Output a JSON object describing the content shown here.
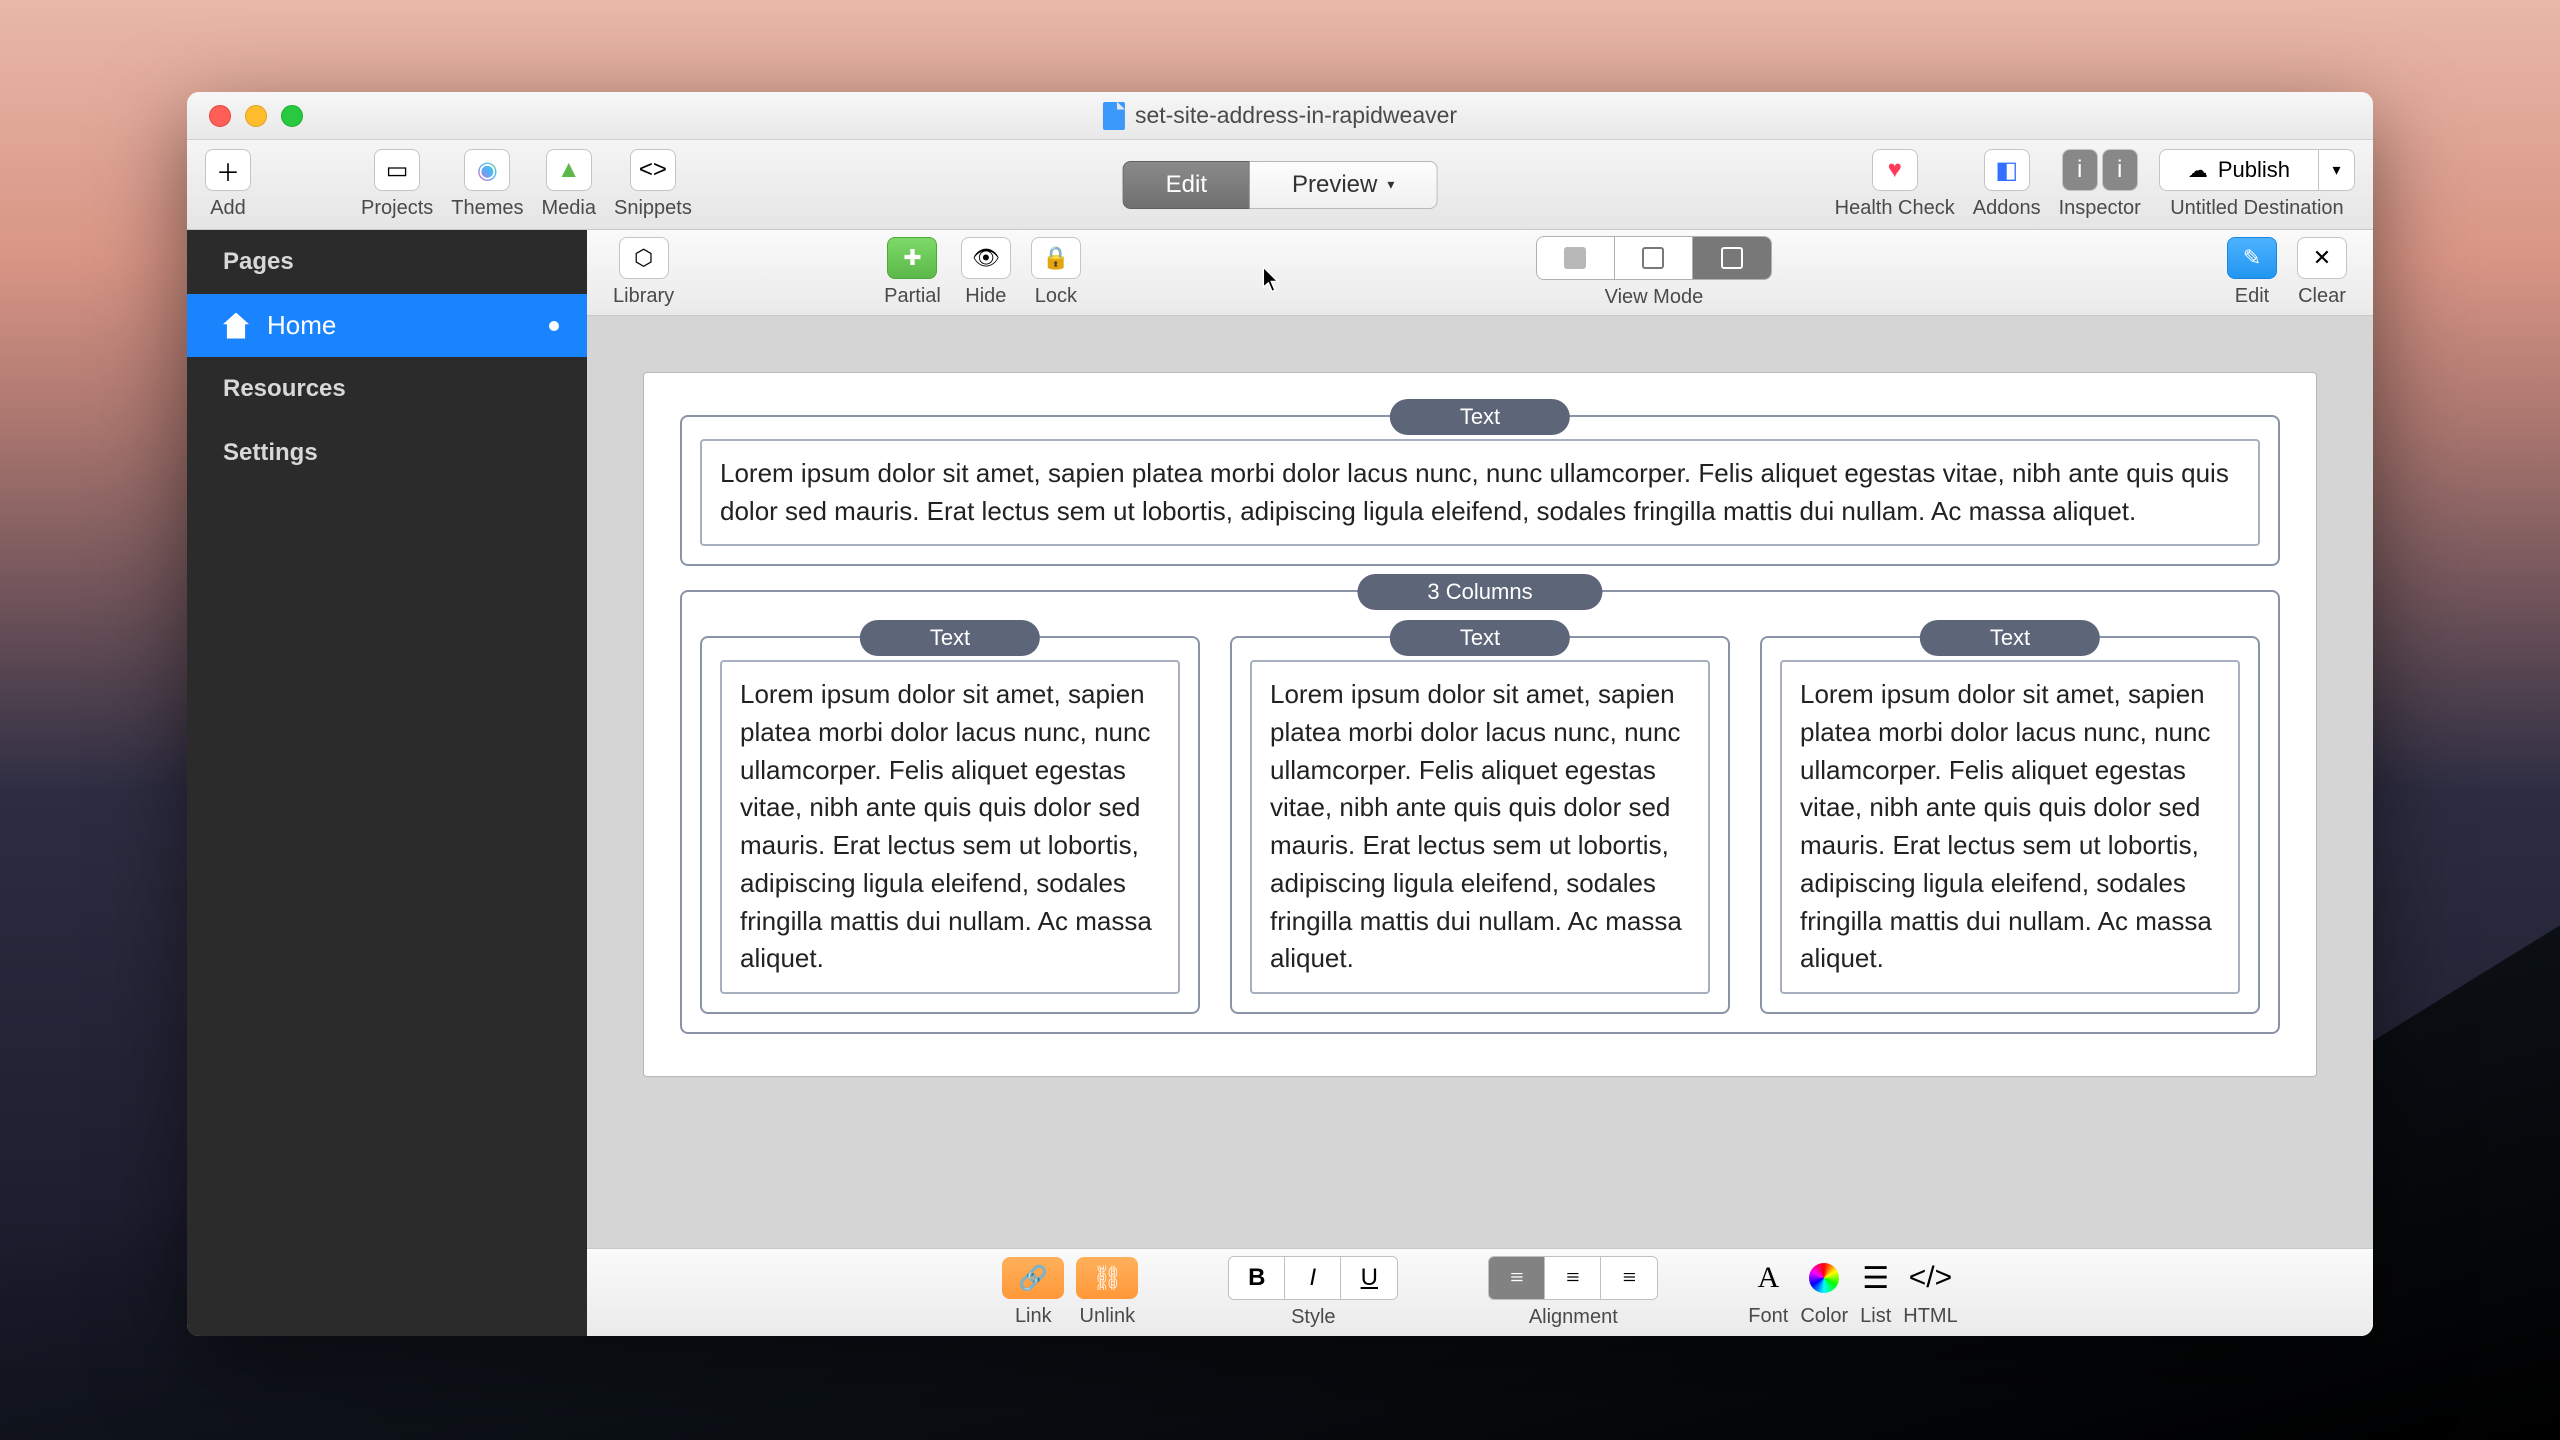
{
  "window": {
    "title": "set-site-address-in-rapidweaver"
  },
  "toolbar": {
    "add": "Add",
    "projects": "Projects",
    "themes": "Themes",
    "media": "Media",
    "snippets": "Snippets",
    "edit": "Edit",
    "preview": "Preview",
    "health": "Health Check",
    "addons": "Addons",
    "inspector": "Inspector",
    "publish": "Publish",
    "destination": "Untitled Destination"
  },
  "sidebar": {
    "pages": "Pages",
    "home": "Home",
    "resources": "Resources",
    "settings": "Settings"
  },
  "subtoolbar": {
    "library": "Library",
    "partial": "Partial",
    "hide": "Hide",
    "lock": "Lock",
    "viewmode": "View Mode",
    "edit": "Edit",
    "clear": "Clear"
  },
  "canvas": {
    "text_label": "Text",
    "cols_label": "3 Columns",
    "lorem": "Lorem ipsum dolor sit amet, sapien platea morbi dolor lacus nunc, nunc ullamcorper. Felis aliquet egestas vitae, nibh ante quis quis dolor sed mauris. Erat lectus sem ut lobortis, adipiscing ligula eleifend, sodales fringilla mattis dui nullam. Ac massa aliquet."
  },
  "bottombar": {
    "link": "Link",
    "unlink": "Unlink",
    "style": "Style",
    "alignment": "Alignment",
    "font": "Font",
    "color": "Color",
    "list": "List",
    "html": "HTML"
  }
}
